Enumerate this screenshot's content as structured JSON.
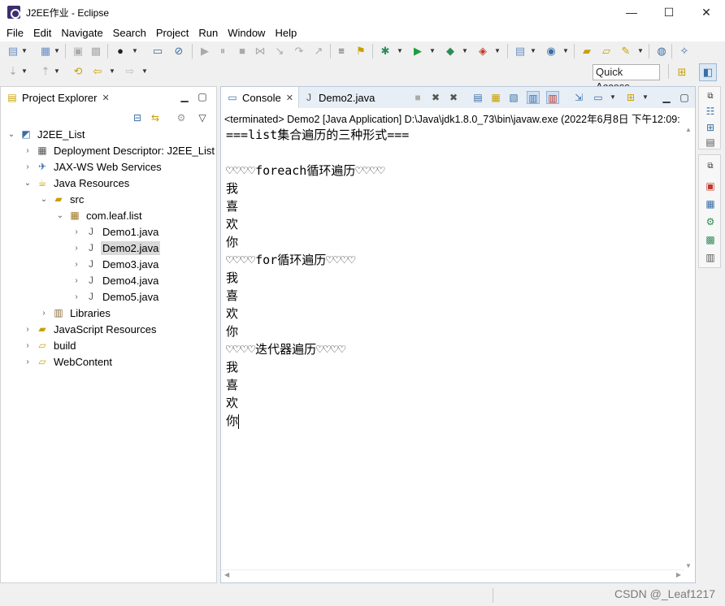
{
  "window": {
    "title": "J2EE作业 - Eclipse",
    "minimize_glyph": "—",
    "maximize_glyph": "☐",
    "close_glyph": "✕"
  },
  "menu": [
    "File",
    "Edit",
    "Navigate",
    "Search",
    "Project",
    "Run",
    "Window",
    "Help"
  ],
  "toolbar": {
    "quick_access": "Quick Access"
  },
  "explorer": {
    "tab_label": "Project Explorer",
    "tree": [
      {
        "label": "J2EE_List",
        "icon": "project-icon",
        "expanded": true
      },
      {
        "label": "Deployment Descriptor: J2EE_List",
        "icon": "deployment-descriptor-icon",
        "expanded": false
      },
      {
        "label": "JAX-WS Web Services",
        "icon": "web-services-icon",
        "expanded": false
      },
      {
        "label": "Java Resources",
        "icon": "java-resources-icon",
        "expanded": true
      },
      {
        "label": "src",
        "icon": "source-folder-icon",
        "expanded": true
      },
      {
        "label": "com.leaf.list",
        "icon": "package-icon",
        "expanded": true
      },
      {
        "label": "Demo1.java",
        "icon": "java-file-icon",
        "expanded": false
      },
      {
        "label": "Demo2.java",
        "icon": "java-file-icon",
        "expanded": false,
        "selected": true
      },
      {
        "label": "Demo3.java",
        "icon": "java-file-icon",
        "expanded": false
      },
      {
        "label": "Demo4.java",
        "icon": "java-file-icon",
        "expanded": false
      },
      {
        "label": "Demo5.java",
        "icon": "java-file-icon",
        "expanded": false
      },
      {
        "label": "Libraries",
        "icon": "libraries-icon",
        "expanded": false
      },
      {
        "label": "JavaScript Resources",
        "icon": "javascript-resources-icon",
        "expanded": false
      },
      {
        "label": "build",
        "icon": "folder-icon",
        "expanded": false
      },
      {
        "label": "WebContent",
        "icon": "folder-icon",
        "expanded": false
      }
    ]
  },
  "console": {
    "tabs": [
      {
        "label": "Console",
        "icon": "console-icon",
        "active": true
      },
      {
        "label": "Demo2.java",
        "icon": "java-file-icon",
        "active": false
      }
    ],
    "status": "<terminated> Demo2 [Java Application] D:\\Java\\jdk1.8.0_73\\bin\\javaw.exe (2022年6月8日 下午12:09:",
    "output": [
      "===list集合遍历的三种形式===",
      "",
      "♡♡♡♡foreach循环遍历♡♡♡♡",
      "我",
      "喜",
      "欢",
      "你",
      "♡♡♡♡for循环遍历♡♡♡♡",
      "我",
      "喜",
      "欢",
      "你",
      "♡♡♡♡迭代器遍历♡♡♡♡",
      "我",
      "喜",
      "欢",
      "你"
    ]
  },
  "watermark": "CSDN @_Leaf1217"
}
